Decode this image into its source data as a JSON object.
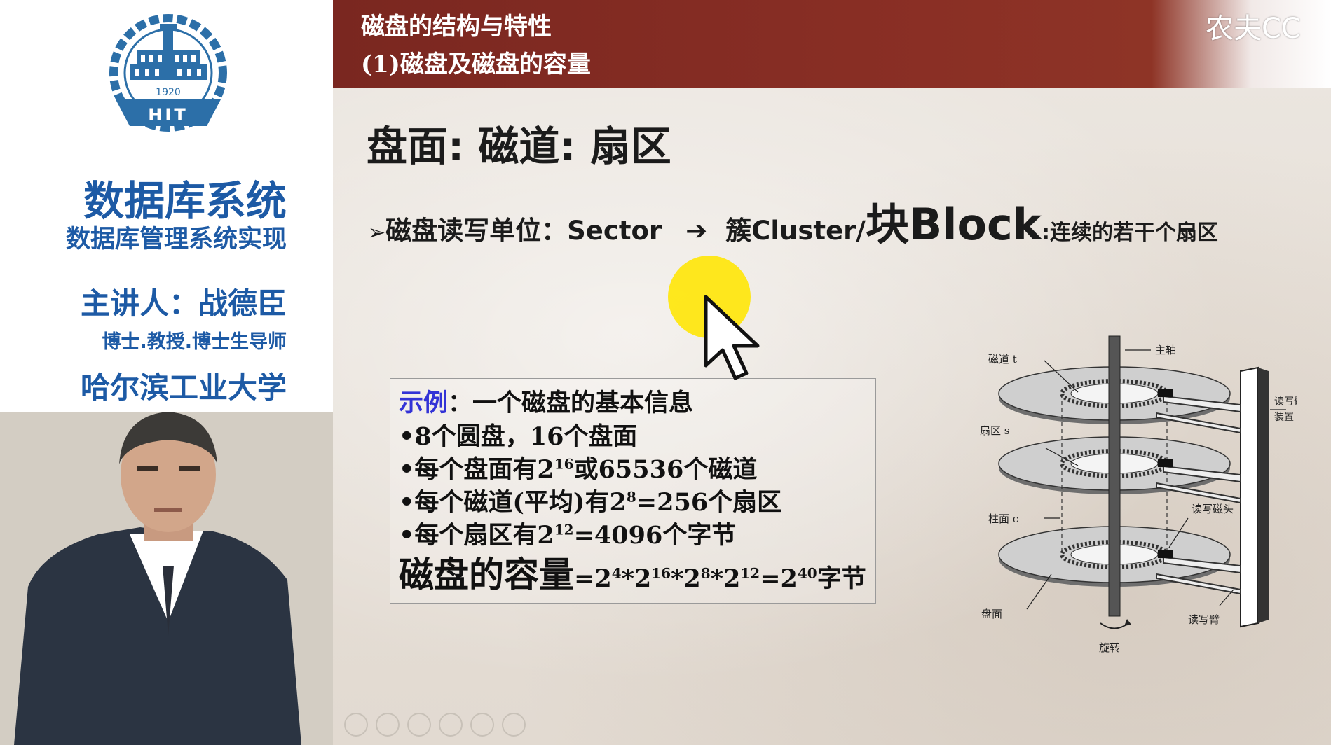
{
  "sidebar": {
    "logo": {
      "year": "1920",
      "abbr": "HIT"
    },
    "course_title": "数据库系统",
    "course_subtitle": "数据库管理系统实现",
    "lecturer": "主讲人：战德臣",
    "lecturer_title": "博士.教授.博士生导师",
    "university": "哈尔滨工业大学"
  },
  "slide": {
    "header": {
      "line1": "磁盘的结构与特性",
      "line2": "(1)磁盘及磁盘的容量"
    },
    "watermark": "农夫CC",
    "title": "盘面: 磁道: 扇区",
    "bullet": {
      "marker": "➢",
      "text1": "磁盘读写单位：Sector",
      "arrow": "➔",
      "text2": "簇Cluster/",
      "big": "块Block",
      "small": ":连续的若干个扇区"
    },
    "example": {
      "label": "示例",
      "heading_rest": "：一个磁盘的基本信息",
      "line1": "•8个圆盘，16个盘面",
      "line2_pre": "•每个盘面有2",
      "line2_exp": "16",
      "line2_post": "或65536个磁道",
      "line3_pre": "•每个磁道(平均)有2",
      "line3_exp": "8",
      "line3_post": "=256个扇区",
      "line4_pre": "•每个扇区有2",
      "line4_exp": "12",
      "line4_post": "=4096个字节",
      "cap_label": "磁盘的容量",
      "cap_eq1": "=2",
      "cap_exp1": "4",
      "cap_eq2": "*2",
      "cap_exp2": "16",
      "cap_eq3": "*2",
      "cap_exp3": "8",
      "cap_eq4": "*2",
      "cap_exp4": "12",
      "cap_eq5": "=2",
      "cap_exp5": "40",
      "cap_unit": "字节"
    },
    "diagram_labels": {
      "track": "磁道 t",
      "spindle": "主轴",
      "arm_assembly_1": "读写臂",
      "arm_assembly_2": "装置",
      "sector": "扇区 s",
      "cylinder": "柱面 c",
      "head": "读写磁头",
      "surface": "盘面",
      "arm": "读写臂",
      "rotation": "旋转"
    }
  },
  "colors": {
    "header_bg": "#7a2720",
    "sidebar_text": "#1d5aa5",
    "example_label": "#3232d6",
    "highlight": "#ffe600"
  }
}
